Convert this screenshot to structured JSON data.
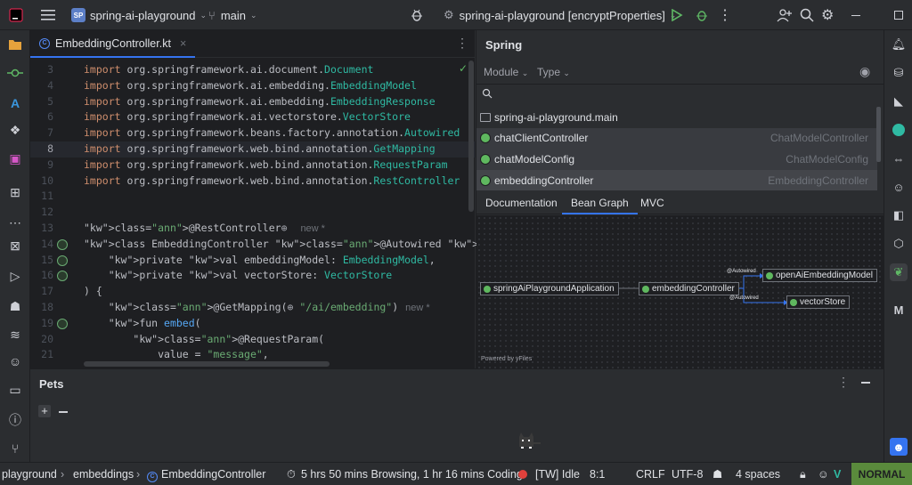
{
  "titlebar": {
    "project_badge": "SP",
    "project_name": "spring-ai-playground",
    "branch": "main",
    "run_config": "spring-ai-playground [encryptProperties]"
  },
  "editor": {
    "tab_label": "EmbeddingController.kt",
    "lines": [
      {
        "n": "3",
        "text": "import org.springframework.ai.document.",
        "tail": "Document"
      },
      {
        "n": "4",
        "text": "import org.springframework.ai.embedding.",
        "tail": "EmbeddingModel"
      },
      {
        "n": "5",
        "text": "import org.springframework.ai.embedding.",
        "tail": "EmbeddingResponse"
      },
      {
        "n": "6",
        "text": "import org.springframework.ai.vectorstore.",
        "tail": "VectorStore"
      },
      {
        "n": "7",
        "text": "import org.springframework.beans.factory.annotation.",
        "tail": "Autowired"
      },
      {
        "n": "8",
        "text": "import org.springframework.web.bind.annotation.",
        "tail": "GetMapping"
      },
      {
        "n": "9",
        "text": "import org.springframework.web.bind.annotation.",
        "tail": "RequestParam"
      },
      {
        "n": "10",
        "text": "import org.springframework.web.bind.annotation.",
        "tail": "RestController"
      },
      {
        "n": "11",
        "text": ""
      },
      {
        "n": "12",
        "text": ""
      },
      {
        "n": "13",
        "text": "@RestController"
      },
      {
        "n": "14",
        "text": "class EmbeddingController @Autowired constructor("
      },
      {
        "n": "15",
        "text": "    private val embeddingModel: EmbeddingModel,"
      },
      {
        "n": "16",
        "text": "    private val vectorStore: VectorStore"
      },
      {
        "n": "17",
        "text": ") {"
      },
      {
        "n": "18",
        "text": "    @GetMapping(\"/ai/embedding\")"
      },
      {
        "n": "19",
        "text": "    fun embed("
      },
      {
        "n": "20",
        "text": "        @RequestParam("
      },
      {
        "n": "21",
        "text": "            value = \"message\","
      }
    ],
    "hint_new": "new *"
  },
  "spring": {
    "title": "Spring",
    "module_label": "Module",
    "type_label": "Type",
    "tree": [
      {
        "name": "spring-ai-playground.main",
        "cls": ""
      },
      {
        "name": "chatClientController",
        "cls": "ChatModelController"
      },
      {
        "name": "chatModelConfig",
        "cls": "ChatModelConfig"
      },
      {
        "name": "embeddingController",
        "cls": "EmbeddingController"
      }
    ],
    "tabs": [
      "Documentation",
      "Bean Graph",
      "MVC"
    ],
    "graph": {
      "nodes": [
        "springAiPlaygroundApplication",
        "embeddingController",
        "openAiEmbeddingModel",
        "vectorStore"
      ],
      "edge_label": "@Autowired",
      "powered_by": "Powered by yFiles"
    }
  },
  "pets": {
    "title": "Pets"
  },
  "status": {
    "crumb1": "playground",
    "crumb2": "embeddings",
    "crumb3": "EmbeddingController",
    "time": "5 hrs 50 mins Browsing, 1 hr 16 mins Coding",
    "idle": "[TW] Idle",
    "pos": "8:1",
    "eol": "CRLF",
    "enc": "UTF-8",
    "indent": "4 spaces",
    "mode": "NORMAL"
  }
}
